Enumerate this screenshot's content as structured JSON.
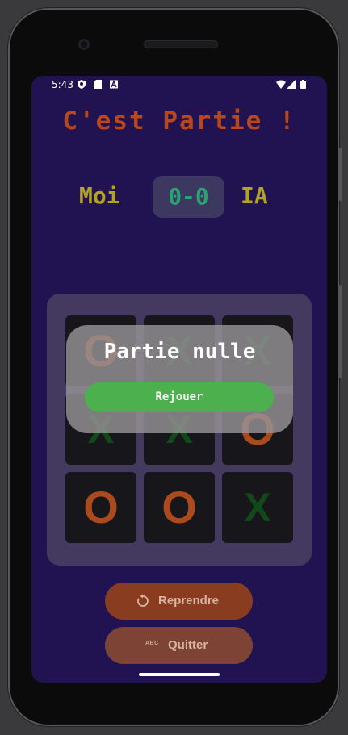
{
  "status_bar": {
    "time": "5:43"
  },
  "game": {
    "title": "C'est Partie !",
    "player_label": "Moi",
    "opponent_label": "IA",
    "score": "0-0",
    "board": [
      "O",
      "X",
      "X",
      "X",
      "X",
      "O",
      "O",
      "O",
      "X"
    ]
  },
  "dialog": {
    "title": "Partie nulle",
    "replay_label": "Rejouer"
  },
  "actions": {
    "resume_label": "Reprendre",
    "quit_label": "Quitter",
    "quit_icon_text": "ABC"
  },
  "colors": {
    "screen_bg": "#211351",
    "title": "#b8471e",
    "player_labels": "#b3a324",
    "score": "#2aa372",
    "o_mark": "#ab4a1c",
    "x_mark": "#124918",
    "replay_button": "#4cb04e",
    "resume_button": "#8a3c21",
    "quit_button": "#7d4436"
  },
  "icons": {
    "resume": "refresh-icon",
    "quit": "abc-icon",
    "status": [
      "shield-icon",
      "sd-card-icon",
      "a-icon",
      "wifi-icon",
      "signal-icon",
      "battery-icon"
    ]
  }
}
